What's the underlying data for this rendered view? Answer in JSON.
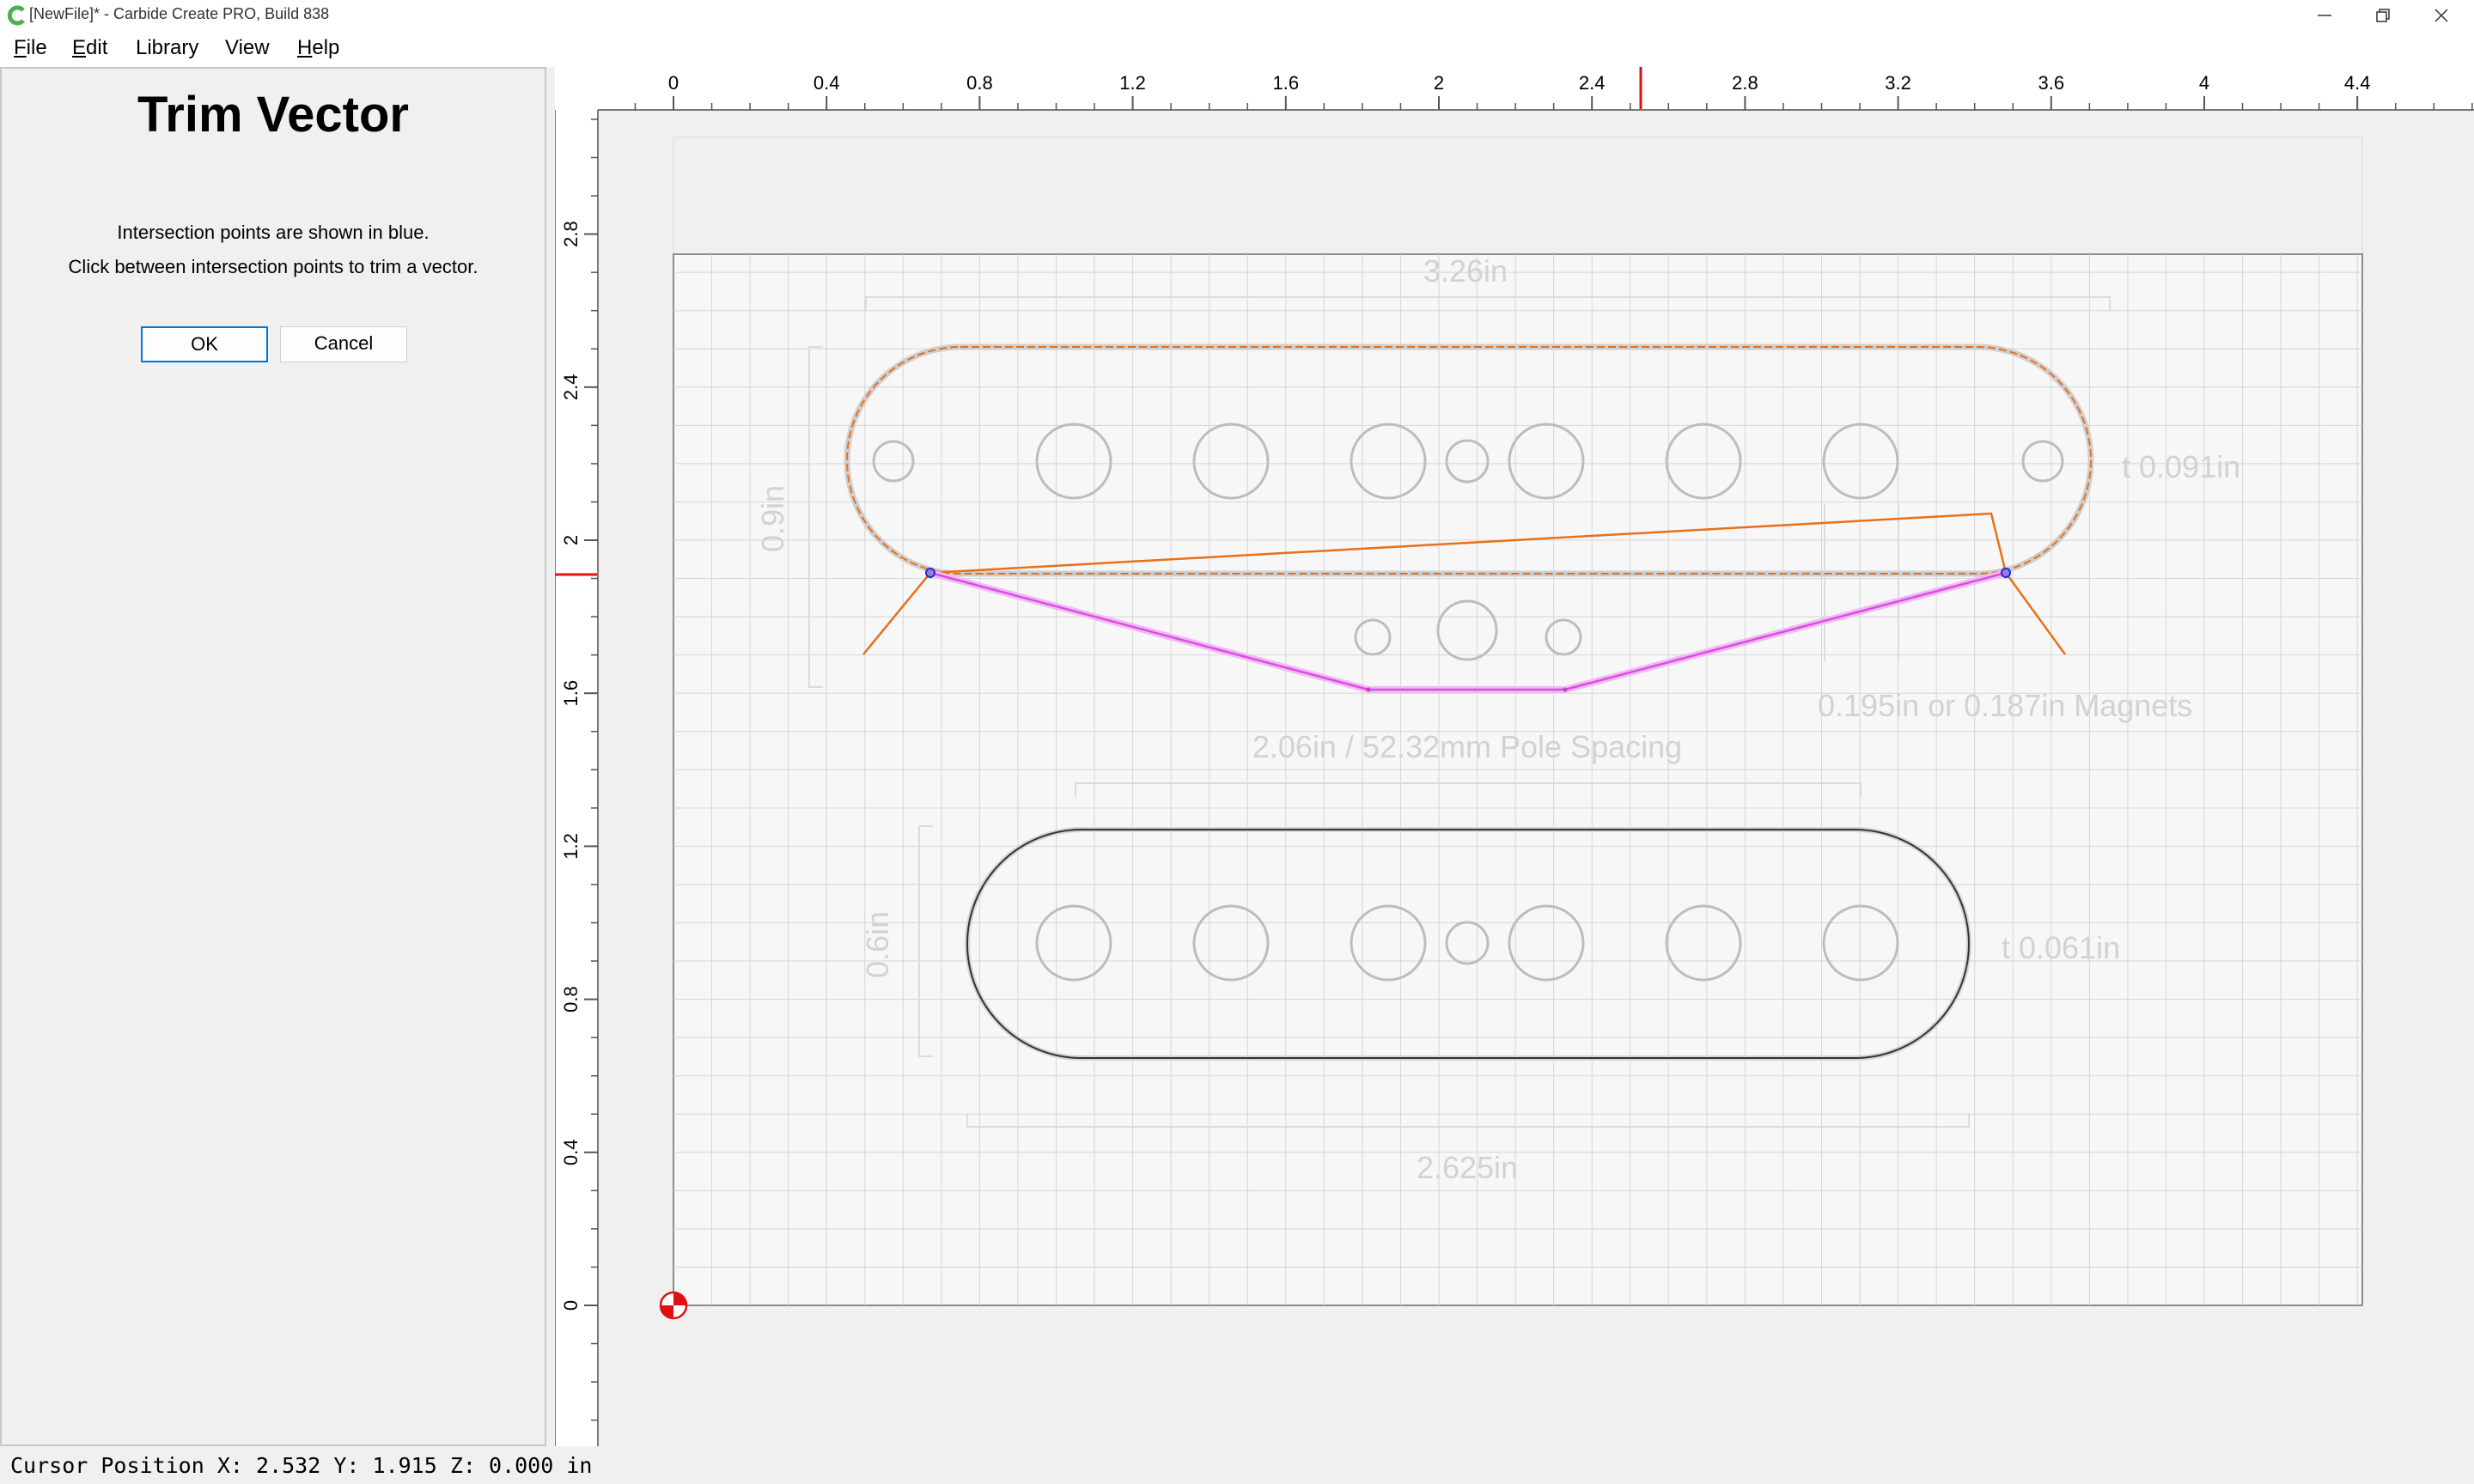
{
  "window": {
    "title": "[NewFile]* - Carbide Create PRO, Build 838",
    "accent_color": "#4caf50"
  },
  "menu": {
    "items": [
      {
        "label": "File",
        "mnemonic": "F",
        "rest": "ile"
      },
      {
        "label": "Edit",
        "mnemonic": "E",
        "rest": "dit"
      },
      {
        "label": "Library",
        "mnemonic": "",
        "rest": "Library"
      },
      {
        "label": "View",
        "mnemonic": "",
        "rest": "View"
      },
      {
        "label": "Help",
        "mnemonic": "H",
        "rest": "elp"
      }
    ]
  },
  "panel": {
    "title": "Trim Vector",
    "instruction_1": "Intersection points are shown in blue.",
    "instruction_2": "Click between intersection points to trim a vector.",
    "ok_label": "OK",
    "cancel_label": "Cancel"
  },
  "canvas": {
    "units": "in",
    "ruler_h_labels": [
      "0",
      "0.4",
      "0.8",
      "1.2",
      "1.6",
      "2",
      "2.4",
      "2.8",
      "3.2",
      "3.6",
      "4",
      "4.4"
    ],
    "ruler_v_labels": [
      "0",
      "0.4",
      "0.8",
      "1.2",
      "1.6",
      "2",
      "2.4",
      "2.8"
    ],
    "annotations": {
      "width_top": "3.26in",
      "height_top": "0.9in",
      "thickness_top": "t 0.091in",
      "magnets": "0.195in or 0.187in Magnets",
      "pole_spacing": "2.06in / 52.32mm Pole Spacing",
      "height_bottom": "0.6in",
      "thickness_bottom": "t 0.061in",
      "width_bottom": "2.625in"
    },
    "colors": {
      "selected_vector": "#e8701a",
      "trim_preview": "#d84ee0",
      "intersection_point": "#1a2fd6",
      "cursor_marker": "#e01010",
      "grid": "#d6d6d6"
    }
  },
  "status": {
    "label": "Cursor Position",
    "x_label": "X:",
    "x": "2.532",
    "y_label": "Y:",
    "y": "1.915",
    "z_label": "Z:",
    "z": "0.000",
    "unit": "in"
  }
}
